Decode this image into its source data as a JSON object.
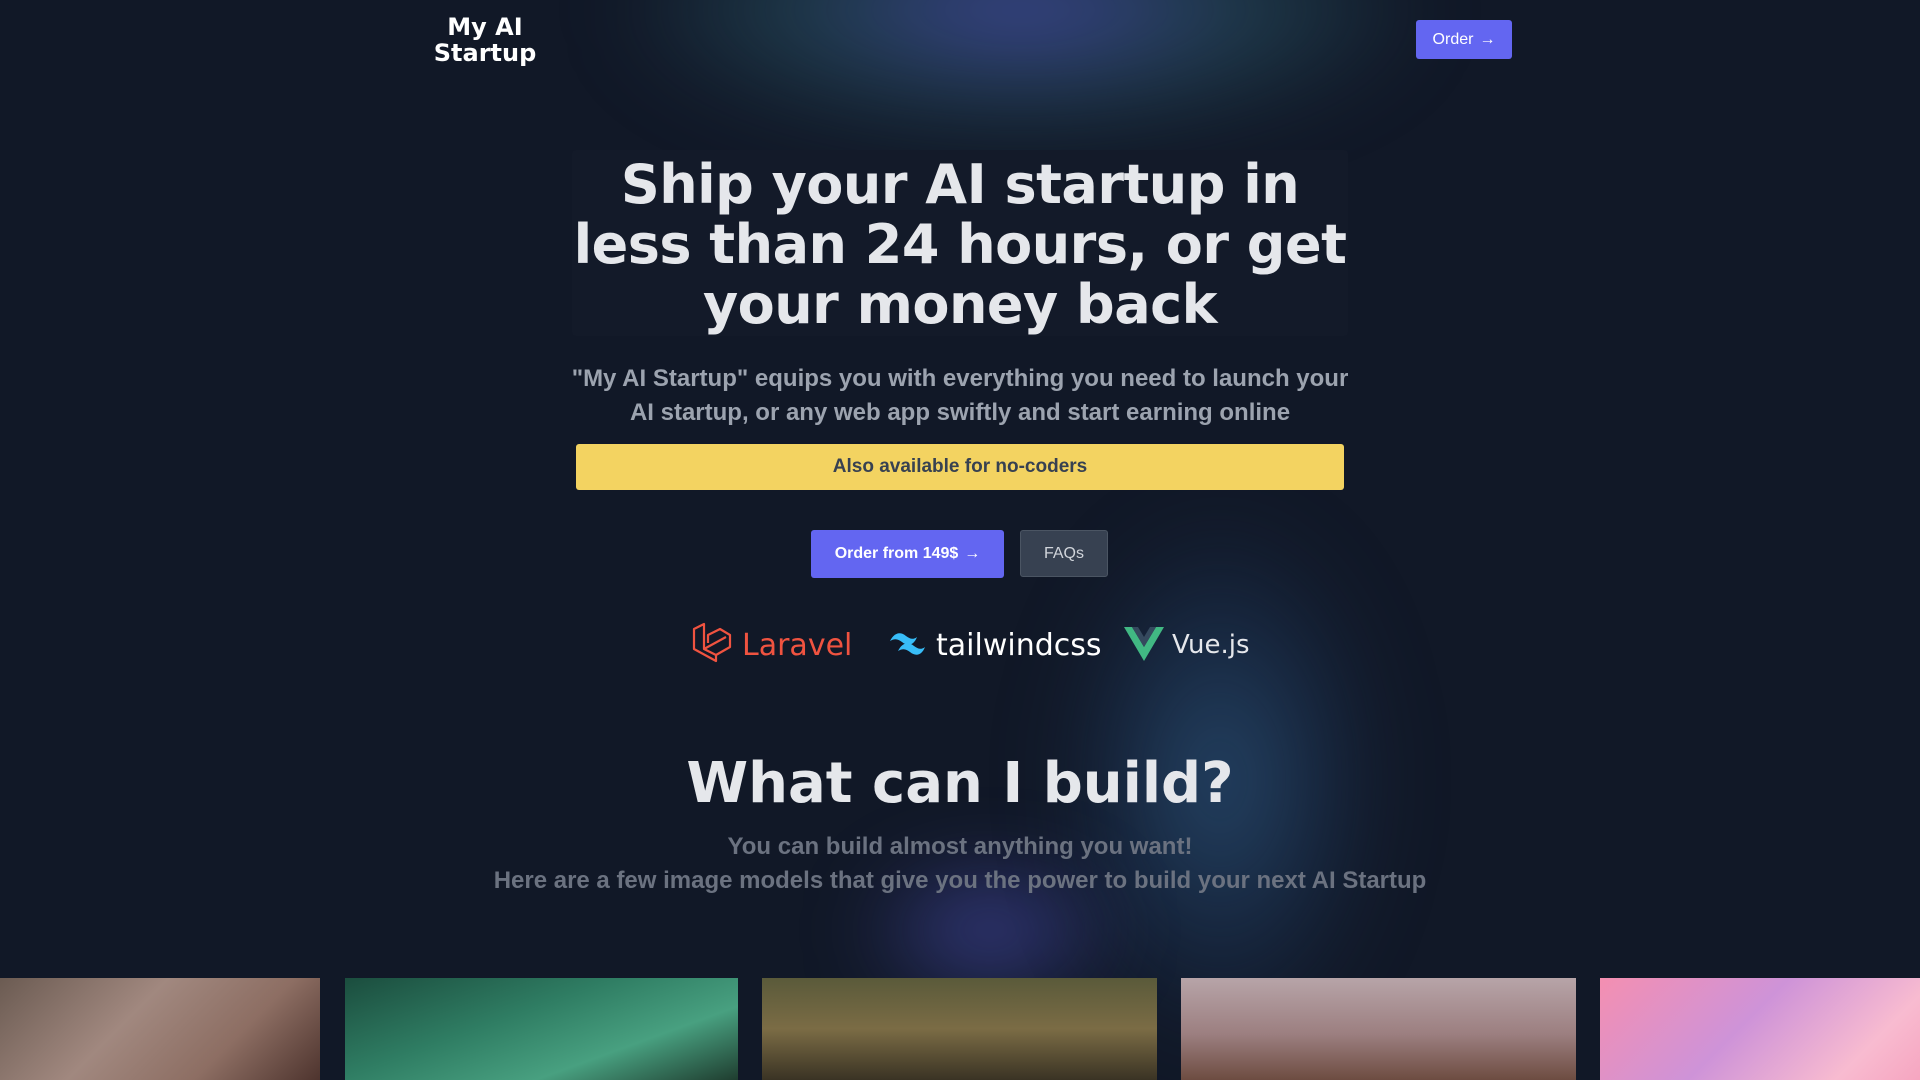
{
  "header": {
    "logo_text": "My AI Startup",
    "order_button": {
      "label": "Order",
      "icon": "arrow-right-icon"
    }
  },
  "hero": {
    "title": "Ship your AI startup in less than 24 hours, or get your money back",
    "subtitle": "\"My AI Startup\" equips you with everything you need to launch your AI startup, or any web app swiftly and start earning online",
    "banner": "Also available for no-coders",
    "primary_button": {
      "label": "Order from 149$",
      "icon": "arrow-right-icon"
    },
    "secondary_button": {
      "label": "FAQs"
    }
  },
  "tech_stack": [
    {
      "name": "Laravel",
      "icon": "laravel-logo-icon",
      "color": "#f05340"
    },
    {
      "name": "tailwindcss",
      "icon": "tailwind-logo-icon",
      "color": "#38bdf8"
    },
    {
      "name": "Vue.js",
      "icon": "vue-logo-icon",
      "color": "#41b883"
    }
  ],
  "build_section": {
    "title": "What can I build?",
    "subtitle_line1": "You can build almost anything you want!",
    "subtitle_line2": "Here are a few image models that give you the power to build your next AI Startup"
  },
  "gallery": [
    {
      "label": "portrait-image"
    },
    {
      "label": "cartoon-tiger-image"
    },
    {
      "label": "mona-lisa-image"
    },
    {
      "label": "astronaut-horse-image"
    },
    {
      "label": "rainbow-unicorn-astronaut-image"
    }
  ],
  "colors": {
    "background": "#111827",
    "accent": "#6366f1",
    "banner": "#f3d361"
  }
}
